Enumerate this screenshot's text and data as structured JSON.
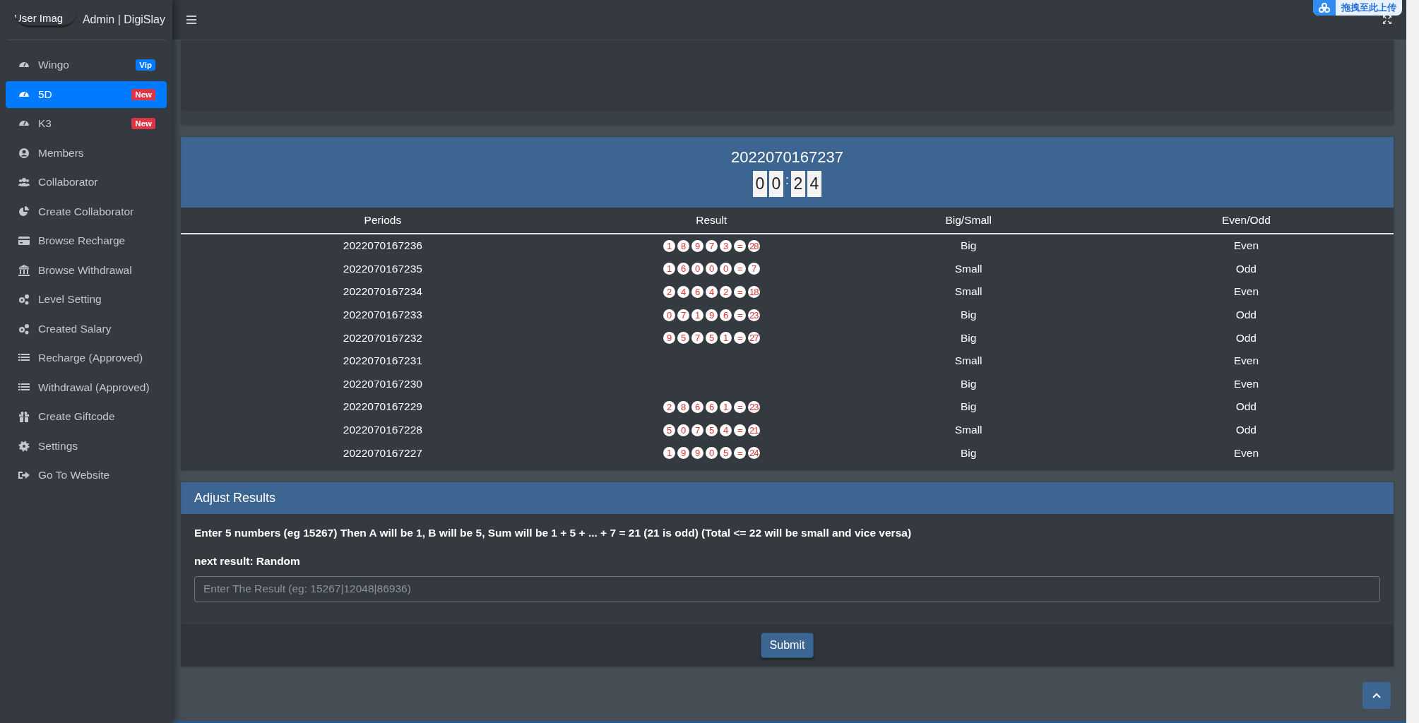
{
  "header": {
    "user_image": "User Imag",
    "brand": "Admin | DigiSlay",
    "upload_badge": "拖拽至此上传"
  },
  "sidebar": {
    "items": [
      {
        "label": "Wingo",
        "selected": false,
        "badge": {
          "text": "Vip",
          "color": "#007bff"
        }
      },
      {
        "label": "5D",
        "selected": true,
        "badge": {
          "text": "New",
          "color": "#dc3545"
        }
      },
      {
        "label": "K3",
        "selected": false,
        "badge": {
          "text": "New",
          "color": "#dc3545"
        }
      },
      {
        "label": "Members",
        "selected": false
      },
      {
        "label": "Collaborator",
        "selected": false
      },
      {
        "label": "Create Collaborator",
        "selected": false
      },
      {
        "label": "Browse Recharge",
        "selected": false
      },
      {
        "label": "Browse Withdrawal",
        "selected": false
      },
      {
        "label": "Level Setting",
        "selected": false
      },
      {
        "label": "Created Salary",
        "selected": false
      },
      {
        "label": "Recharge (Approved)",
        "selected": false
      },
      {
        "label": "Withdrawal (Approved)",
        "selected": false
      },
      {
        "label": "Create Giftcode",
        "selected": false
      },
      {
        "label": "Settings",
        "selected": false
      },
      {
        "label": "Go To Website",
        "selected": false
      }
    ]
  },
  "game": {
    "period": "2022070167237",
    "countdown": [
      "0",
      "0",
      "2",
      "4"
    ],
    "separator": ":",
    "table": {
      "columns": [
        "Periods",
        "Result",
        "Big/Small",
        "Even/Odd"
      ],
      "rows": [
        {
          "period": "2022070167236",
          "result": [
            "1",
            "8",
            "9",
            "7",
            "3",
            "=",
            "28"
          ],
          "size": "Big",
          "parity": "Even"
        },
        {
          "period": "2022070167235",
          "result": [
            "1",
            "6",
            "0",
            "0",
            "0",
            "=",
            "7"
          ],
          "size": "Small",
          "parity": "Odd"
        },
        {
          "period": "2022070167234",
          "result": [
            "2",
            "4",
            "6",
            "4",
            "2",
            "=",
            "18"
          ],
          "size": "Small",
          "parity": "Even"
        },
        {
          "period": "2022070167233",
          "result": [
            "0",
            "7",
            "1",
            "9",
            "6",
            "=",
            "23"
          ],
          "size": "Big",
          "parity": "Odd"
        },
        {
          "period": "2022070167232",
          "result": [
            "9",
            "5",
            "7",
            "5",
            "1",
            "=",
            "27"
          ],
          "size": "Big",
          "parity": "Odd"
        },
        {
          "period": "2022070167231",
          "size": "Small",
          "parity": "Even"
        },
        {
          "period": "2022070167230",
          "size": "Big",
          "parity": "Even"
        },
        {
          "period": "2022070167229",
          "result": [
            "2",
            "8",
            "6",
            "6",
            "1",
            "=",
            "23"
          ],
          "size": "Big",
          "parity": "Odd"
        },
        {
          "period": "2022070167228",
          "result": [
            "5",
            "0",
            "7",
            "5",
            "4",
            "=",
            "21"
          ],
          "size": "Small",
          "parity": "Odd"
        },
        {
          "period": "2022070167227",
          "result": [
            "1",
            "9",
            "9",
            "0",
            "5",
            "=",
            "24"
          ],
          "size": "Big",
          "parity": "Even"
        }
      ]
    }
  },
  "adjust": {
    "title": "Adjust Results",
    "note": "Enter 5 numbers (eg 15267) Then A will be 1, B will be 5, Sum will be 1 + 5 + ... + 7 = 21 (21 is odd) (Total <= 22 will be small and vice versa)",
    "next_result": "next result: Random",
    "input": {
      "placeholder": "Enter The Result (eg: 15267|12048|86936)"
    },
    "submit": "Submit"
  }
}
